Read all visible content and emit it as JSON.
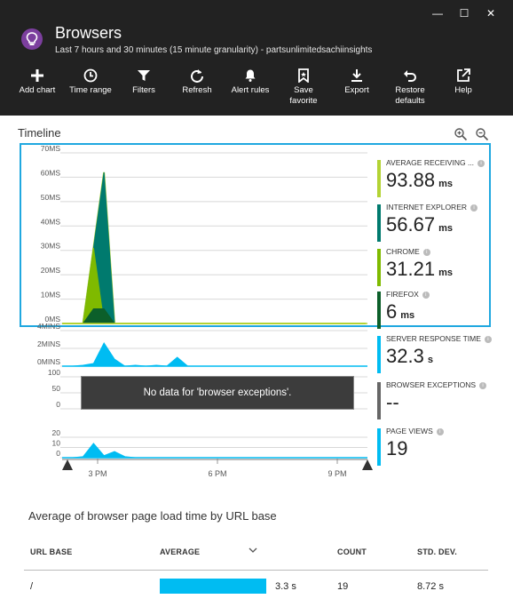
{
  "window": {
    "title": "Browsers",
    "subtitle": "Last 7 hours and 30 minutes (15 minute granularity) - partsunlimitedsachiinsights",
    "controls": [
      "—",
      "☐",
      "✕"
    ]
  },
  "toolbar": {
    "items": [
      {
        "label": "Add chart",
        "icon": "plus-icon"
      },
      {
        "label": "Time range",
        "icon": "clock-icon"
      },
      {
        "label": "Filters",
        "icon": "filter-icon"
      },
      {
        "label": "Refresh",
        "icon": "refresh-icon"
      },
      {
        "label": "Alert rules",
        "icon": "bell-icon"
      },
      {
        "label": "Save\nfavorite",
        "icon": "bookmark-icon"
      },
      {
        "label": "Export",
        "icon": "download-icon"
      },
      {
        "label": "Restore\ndefaults",
        "icon": "undo-icon"
      },
      {
        "label": "Help",
        "icon": "external-link-icon"
      }
    ]
  },
  "timeline": {
    "title": "Timeline",
    "no_data_message": "No data for 'browser exceptions'.",
    "x_ticks": [
      "3 PM",
      "6 PM",
      "9 PM"
    ]
  },
  "metrics": [
    {
      "label": "AVERAGE RECEIVING ...",
      "value": "93.88",
      "unit": "ms",
      "color": "#b3d334"
    },
    {
      "label": "INTERNET EXPLORER",
      "value": "56.67",
      "unit": "ms",
      "color": "#007a6e"
    },
    {
      "label": "CHROME",
      "value": "31.21",
      "unit": "ms",
      "color": "#7fba00"
    },
    {
      "label": "FIREFOX",
      "value": "6",
      "unit": "ms",
      "color": "#0c5f2a"
    },
    {
      "label": "SERVER RESPONSE TIME",
      "value": "32.3",
      "unit": "s",
      "color": "#00bcf2"
    },
    {
      "label": "BROWSER EXCEPTIONS",
      "value": "--",
      "unit": "",
      "color": "#666666"
    },
    {
      "label": "PAGE VIEWS",
      "value": "19",
      "unit": "",
      "color": "#00bcf2"
    }
  ],
  "chart_data": [
    {
      "type": "area",
      "title": "",
      "yticks": [
        "70MS",
        "60MS",
        "50MS",
        "40MS",
        "30MS",
        "20MS",
        "10MS",
        "0MS"
      ],
      "ylim": [
        0,
        70
      ],
      "x_index": [
        0,
        1,
        2,
        3,
        4,
        5,
        6,
        7,
        8,
        9,
        10,
        11,
        12,
        13,
        14,
        15,
        16,
        17,
        18,
        19,
        20,
        21,
        22,
        23,
        24,
        25,
        26,
        27,
        28,
        29
      ],
      "series": [
        {
          "name": "AVERAGE RECEIVING ...",
          "color": "#b3d334",
          "values": [
            0,
            0,
            0,
            31,
            62,
            0,
            0,
            0,
            0,
            0,
            0,
            0,
            0,
            0,
            0,
            0,
            0,
            0,
            0,
            0,
            0,
            0,
            0,
            0,
            0,
            0,
            0,
            0,
            0,
            0
          ]
        },
        {
          "name": "INTERNET EXPLORER",
          "color": "#007a6e",
          "values": [
            0,
            0,
            0,
            31,
            62,
            0,
            0,
            0,
            0,
            0,
            0,
            0,
            0,
            0,
            0,
            0,
            0,
            0,
            0,
            0,
            0,
            0,
            0,
            0,
            0,
            0,
            0,
            0,
            0,
            0
          ]
        },
        {
          "name": "CHROME",
          "color": "#7fba00",
          "values": [
            0,
            0,
            0,
            31,
            0,
            0,
            0,
            0,
            0,
            0,
            0,
            0,
            0,
            0,
            0,
            0,
            0,
            0,
            0,
            0,
            0,
            0,
            0,
            0,
            0,
            0,
            0,
            0,
            0,
            0
          ]
        },
        {
          "name": "FIREFOX",
          "color": "#0c5f2a",
          "values": [
            0,
            0,
            0,
            6,
            6,
            0,
            0,
            0,
            0,
            0,
            0,
            0,
            0,
            0,
            0,
            0,
            0,
            0,
            0,
            0,
            0,
            0,
            0,
            0,
            0,
            0,
            0,
            0,
            0,
            0
          ]
        }
      ]
    },
    {
      "type": "area",
      "title": "",
      "yticks": [
        "4MINS",
        "2MINS",
        "0MINS"
      ],
      "ylim": [
        0,
        4
      ],
      "series": [
        {
          "name": "SERVER RESPONSE TIME",
          "color": "#00bcf2",
          "values": [
            0,
            0,
            0.1,
            0.3,
            2.6,
            0.8,
            0,
            0.1,
            0,
            0.1,
            0,
            1.0,
            0,
            0,
            0,
            0,
            0,
            0,
            0,
            0,
            0,
            0,
            0,
            0,
            0,
            0,
            0,
            0,
            0,
            0
          ]
        }
      ]
    },
    {
      "type": "area",
      "title": "",
      "yticks": [
        "100",
        "50",
        "0"
      ],
      "ylim": [
        0,
        100
      ],
      "series": []
    },
    {
      "type": "area",
      "title": "",
      "yticks": [
        "20",
        "10",
        "0"
      ],
      "ylim": [
        0,
        20
      ],
      "series": [
        {
          "name": "PAGE VIEWS",
          "color": "#00bcf2",
          "values": [
            0,
            0,
            1,
            14,
            2,
            6,
            1,
            0,
            0,
            0,
            0,
            0,
            0,
            0,
            0,
            0,
            0,
            0,
            0,
            0,
            0,
            0,
            0,
            0,
            0,
            0,
            0,
            0,
            0,
            0
          ]
        }
      ]
    }
  ],
  "table": {
    "title": "Average of browser page load time by URL base",
    "columns": [
      "URL BASE",
      "AVERAGE",
      "COUNT",
      "STD. DEV."
    ],
    "rows": [
      {
        "url_base": "/",
        "average": "3.3 s",
        "average_fraction": 1.0,
        "count": "19",
        "std_dev": "8.72 s"
      }
    ]
  }
}
